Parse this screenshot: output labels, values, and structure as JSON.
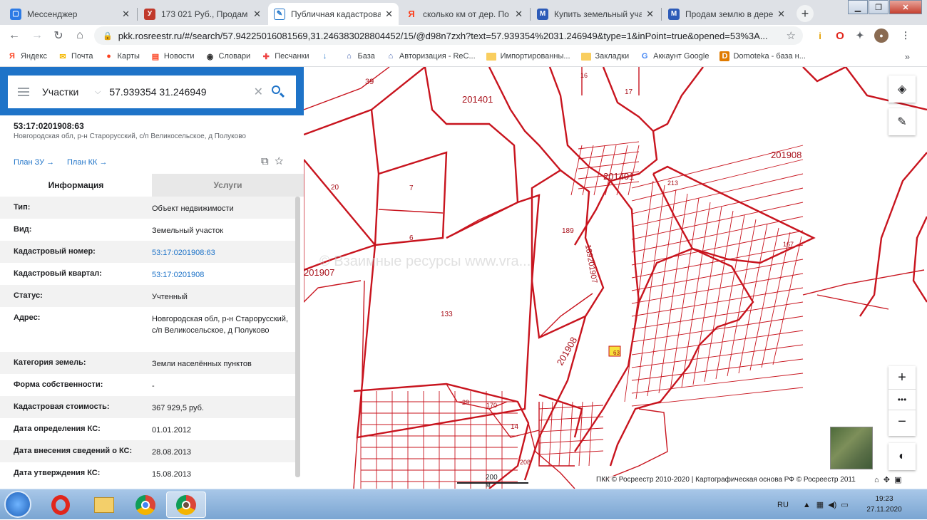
{
  "browser": {
    "tabs": [
      {
        "title": "Мессенджер",
        "favicon_color": "#2d7be5",
        "favicon_letter": "▢"
      },
      {
        "title": "173 021 Руб., Продам у",
        "favicon_color": "#c0392b",
        "favicon_letter": "У"
      },
      {
        "title": "Публичная кадастрова",
        "favicon_color": "#1e73c8",
        "favicon_letter": "✎"
      },
      {
        "title": "сколько км от дер. По",
        "favicon_color": "#fc3f1d",
        "favicon_letter": "Я"
      },
      {
        "title": "Купить земельный учас",
        "favicon_color": "#2d5bb8",
        "favicon_letter": "M"
      },
      {
        "title": "Продам землю в дерев",
        "favicon_color": "#2d5bb8",
        "favicon_letter": "M"
      }
    ],
    "url": "pkk.rosreestr.ru/#/search/57.94225016081569,31.246383028804452/15/@d98n7zxh?text=57.939354%2031.246949&type=1&inPoint=true&opened=53%3A...",
    "bookmarks": [
      {
        "label": "Яндекс",
        "icon": "yandex-icon",
        "color": "#fc3f1d",
        "glyph": "Я"
      },
      {
        "label": "Почта",
        "icon": "mail-icon",
        "color": "#f5b800",
        "glyph": "✉"
      },
      {
        "label": "Карты",
        "icon": "maps-icon",
        "color": "#fc3f1d",
        "glyph": "●"
      },
      {
        "label": "Новости",
        "icon": "news-icon",
        "color": "#fc3f1d",
        "glyph": "▤"
      },
      {
        "label": "Словари",
        "icon": "dictionary-icon",
        "color": "#333",
        "glyph": "◉"
      },
      {
        "label": "Песчанки",
        "icon": "app-icon",
        "color": "#e44",
        "glyph": "✚"
      },
      {
        "label": "",
        "icon": "download-icon",
        "color": "#1e73c8",
        "glyph": "↓"
      },
      {
        "label": "База",
        "icon": "home-icon",
        "color": "#3b5bab",
        "glyph": "⌂"
      },
      {
        "label": "Авторизация - ReC...",
        "icon": "home-icon",
        "color": "#3b5bab",
        "glyph": "⌂"
      },
      {
        "label": "Импортированны...",
        "icon": "folder-icon",
        "color": "#f9ce5f",
        "glyph": ""
      },
      {
        "label": "Закладки",
        "icon": "folder-icon",
        "color": "#f9ce5f",
        "glyph": ""
      },
      {
        "label": "Аккаунт Google",
        "icon": "google-icon",
        "color": "#4285f4",
        "glyph": "G"
      },
      {
        "label": "Domoteka - база н...",
        "icon": "domoteka-icon",
        "color": "#e07b00",
        "glyph": "D"
      }
    ],
    "more_glyph": "»"
  },
  "search": {
    "type_label": "Участки",
    "query": "57.939354 31.246949"
  },
  "parcel": {
    "cad_number": "53:17:0201908:63",
    "address_short": "Новгородская обл, р-н Старорусский, с/п Великосельское, д Полуково",
    "plan_zu": "План ЗУ →",
    "plan_kk": "План КК →",
    "tab_info": "Информация",
    "tab_services": "Услуги",
    "rows": [
      {
        "key": "Тип:",
        "value": "Объект недвижимости"
      },
      {
        "key": "Вид:",
        "value": "Земельный участок"
      },
      {
        "key": "Кадастровый номер:",
        "value": "53:17:0201908:63",
        "link": true
      },
      {
        "key": "Кадастровый квартал:",
        "value": "53:17:0201908",
        "link": true
      },
      {
        "key": "Статус:",
        "value": "Учтенный"
      },
      {
        "key": "Адрес:",
        "value": "Новгородская обл, р-н Старорусский, с/п Великосельское, д Полуково",
        "tall": true
      },
      {
        "key": "Категория земель:",
        "value": "Земли населённых пунктов"
      },
      {
        "key": "Форма собственности:",
        "value": "-"
      },
      {
        "key": "Кадастровая стоимость:",
        "value": "367 929,5 руб."
      },
      {
        "key": "Дата определения КС:",
        "value": "01.01.2012"
      },
      {
        "key": "Дата внесения сведений о КС:",
        "value": "28.08.2013"
      },
      {
        "key": "Дата утверждения КС:",
        "value": "15.08.2013"
      }
    ]
  },
  "map": {
    "line_color": "#c8141e",
    "highlight_color": "#f7e23c",
    "labels": [
      {
        "t": "39",
        "big": false
      },
      {
        "t": "201401",
        "big": true
      },
      {
        "t": "16",
        "big": false
      },
      {
        "t": "17",
        "big": false
      },
      {
        "t": "201908",
        "big": true
      },
      {
        "t": "20",
        "big": false
      },
      {
        "t": "7",
        "big": false
      },
      {
        "t": "201401",
        "big": true
      },
      {
        "t": "213",
        "big": false
      },
      {
        "t": "6",
        "big": false
      },
      {
        "t": "189",
        "big": false
      },
      {
        "t": "201907",
        "big": true
      },
      {
        "t": "133",
        "big": false
      },
      {
        "t": "201908",
        "big": true
      },
      {
        "t": "63",
        "big": false
      },
      {
        "t": "14",
        "big": false
      },
      {
        "t": "170",
        "big": false
      },
      {
        "t": "29",
        "big": false
      },
      {
        "t": "208",
        "big": false
      },
      {
        "t": "167",
        "big": false
      },
      {
        "t": "189201907",
        "big": true
      }
    ],
    "watermark": "© Взаимные ресурсы www.vra...",
    "scale_label": "200 м",
    "attribution": "ПКК © Росреестр 2010-2020 | Картографическая основа РФ © Росреестр 2011",
    "zoom_in": "+",
    "zoom_more": "•••",
    "zoom_out": "−"
  },
  "taskbar": {
    "lang": "RU",
    "time": "19:23",
    "date": "27.11.2020"
  }
}
